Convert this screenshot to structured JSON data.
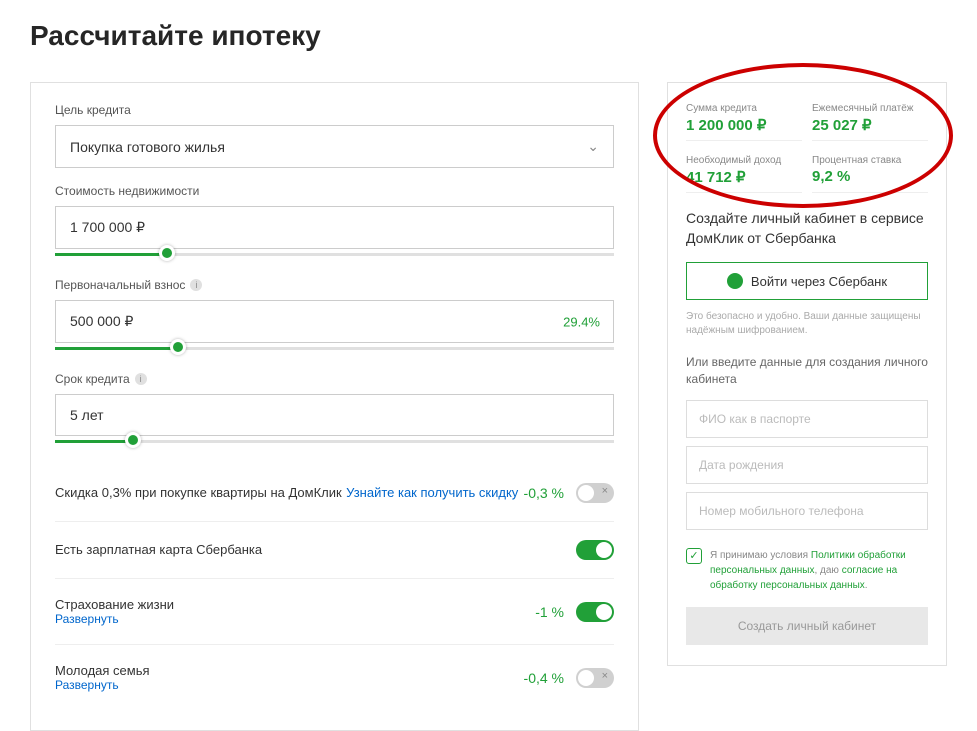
{
  "title": "Рассчитайте ипотеку",
  "form": {
    "purpose_label": "Цель кредита",
    "purpose_value": "Покупка готового жилья",
    "price_label": "Стоимость недвижимости",
    "price_value": "1 700 000 ₽",
    "down_label": "Первоначальный взнос",
    "down_value": "500 000 ₽",
    "down_pct": "29.4%",
    "term_label": "Срок кредита",
    "term_value": "5 лет"
  },
  "options": {
    "discount_title": "Скидка 0,3% при покупке квартиры на ДомКлик",
    "discount_link": "Узнайте как получить скидку",
    "discount_pct": "-0,3 %",
    "salary_title": "Есть зарплатная карта Сбербанка",
    "insurance_title": "Страхование жизни",
    "insurance_pct": "-1 %",
    "young_title": "Молодая семья",
    "young_pct": "-0,4 %",
    "expand": "Развернуть"
  },
  "summary": {
    "loan_label": "Сумма кредита",
    "loan_value": "1 200 000 ₽",
    "monthly_label": "Ежемесячный платёж",
    "monthly_value": "25 027 ₽",
    "income_label": "Необходимый доход",
    "income_value": "41 712 ₽",
    "rate_label": "Процентная ставка",
    "rate_value": "9,2 %"
  },
  "cta": {
    "create_text": "Создайте личный кабинет в сервисе ДомКлик от Сбербанка",
    "sber_btn": "Войти через Сбербанк",
    "fine": "Это безопасно и удобно. Ваши данные защищены надёжным шифрованием.",
    "or_text": "Или введите данные для создания личного кабинета",
    "ph_name": "ФИО как в паспорте",
    "ph_dob": "Дата рождения",
    "ph_phone": "Номер мобильного телефона",
    "consent_prefix": "Я принимаю условия ",
    "consent_link1": "Политики обработки персональных данных",
    "consent_mid": ", даю ",
    "consent_link2": "согласие на обработку персональных данных",
    "create_btn": "Создать личный кабинет"
  }
}
